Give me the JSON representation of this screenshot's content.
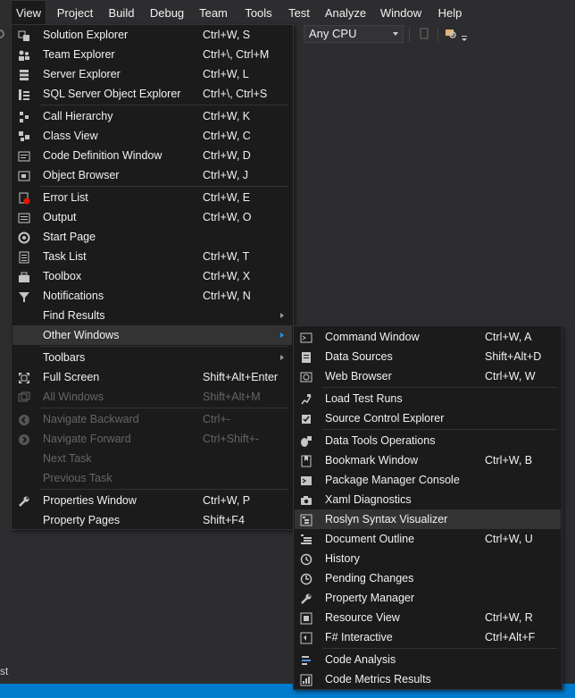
{
  "menubar": [
    "View",
    "Project",
    "Build",
    "Debug",
    "Team",
    "Tools",
    "Test",
    "Analyze",
    "Window",
    "Help"
  ],
  "toolbar": {
    "platform": "Any CPU"
  },
  "left_edge_text": "st",
  "view_menu": [
    {
      "label": "Solution Explorer",
      "shortcut": "Ctrl+W, S",
      "icon": "solution-explorer-icon"
    },
    {
      "label": "Team Explorer",
      "shortcut": "Ctrl+\\, Ctrl+M",
      "icon": "team-explorer-icon"
    },
    {
      "label": "Server Explorer",
      "shortcut": "Ctrl+W, L",
      "icon": "server-explorer-icon"
    },
    {
      "label": "SQL Server Object Explorer",
      "shortcut": "Ctrl+\\, Ctrl+S",
      "icon": "sql-server-icon"
    },
    {
      "label": "Call Hierarchy",
      "shortcut": "Ctrl+W, K",
      "icon": "call-hierarchy-icon"
    },
    {
      "label": "Class View",
      "shortcut": "Ctrl+W, C",
      "icon": "class-view-icon"
    },
    {
      "label": "Code Definition Window",
      "shortcut": "Ctrl+W, D",
      "icon": "code-definition-icon"
    },
    {
      "label": "Object Browser",
      "shortcut": "Ctrl+W, J",
      "icon": "object-browser-icon"
    },
    {
      "label": "Error List",
      "shortcut": "Ctrl+W, E",
      "icon": "error-list-icon"
    },
    {
      "label": "Output",
      "shortcut": "Ctrl+W, O",
      "icon": "output-icon"
    },
    {
      "label": "Start Page",
      "shortcut": "",
      "icon": "start-page-icon"
    },
    {
      "label": "Task List",
      "shortcut": "Ctrl+W, T",
      "icon": "task-list-icon"
    },
    {
      "label": "Toolbox",
      "shortcut": "Ctrl+W, X",
      "icon": "toolbox-icon"
    },
    {
      "label": "Notifications",
      "shortcut": "Ctrl+W, N",
      "icon": "notifications-icon"
    },
    {
      "label": "Find Results",
      "shortcut": "",
      "icon": ""
    },
    {
      "label": "Other Windows",
      "shortcut": "",
      "icon": ""
    },
    {
      "label": "Toolbars",
      "shortcut": "",
      "icon": ""
    },
    {
      "label": "Full Screen",
      "shortcut": "Shift+Alt+Enter",
      "icon": "full-screen-icon"
    },
    {
      "label": "All Windows",
      "shortcut": "Shift+Alt+M",
      "icon": "all-windows-icon"
    },
    {
      "label": "Navigate Backward",
      "shortcut": "Ctrl+-",
      "icon": "navigate-backward-icon"
    },
    {
      "label": "Navigate Forward",
      "shortcut": "Ctrl+Shift+-",
      "icon": "navigate-forward-icon"
    },
    {
      "label": "Next Task",
      "shortcut": "",
      "icon": ""
    },
    {
      "label": "Previous Task",
      "shortcut": "",
      "icon": ""
    },
    {
      "label": "Properties Window",
      "shortcut": "Ctrl+W, P",
      "icon": "wrench-icon"
    },
    {
      "label": "Property Pages",
      "shortcut": "Shift+F4",
      "icon": ""
    }
  ],
  "other_windows_menu": [
    {
      "label": "Command Window",
      "shortcut": "Ctrl+W, A",
      "icon": "command-window-icon"
    },
    {
      "label": "Data Sources",
      "shortcut": "Shift+Alt+D",
      "icon": "data-sources-icon"
    },
    {
      "label": "Web Browser",
      "shortcut": "Ctrl+W, W",
      "icon": "web-browser-icon"
    },
    {
      "label": "Load Test Runs",
      "shortcut": "",
      "icon": "load-test-runs-icon"
    },
    {
      "label": "Source Control Explorer",
      "shortcut": "",
      "icon": "source-control-icon"
    },
    {
      "label": "Data Tools Operations",
      "shortcut": "",
      "icon": "data-tools-icon"
    },
    {
      "label": "Bookmark Window",
      "shortcut": "Ctrl+W, B",
      "icon": "bookmark-icon"
    },
    {
      "label": "Package Manager Console",
      "shortcut": "",
      "icon": "package-manager-icon"
    },
    {
      "label": "Xaml Diagnostics",
      "shortcut": "",
      "icon": "camera-icon"
    },
    {
      "label": "Roslyn Syntax Visualizer",
      "shortcut": "",
      "icon": "syntax-visualizer-icon"
    },
    {
      "label": "Document Outline",
      "shortcut": "Ctrl+W, U",
      "icon": "document-outline-icon"
    },
    {
      "label": "History",
      "shortcut": "",
      "icon": "history-icon"
    },
    {
      "label": "Pending Changes",
      "shortcut": "",
      "icon": "pending-changes-icon"
    },
    {
      "label": "Property Manager",
      "shortcut": "",
      "icon": "wrench-icon"
    },
    {
      "label": "Resource View",
      "shortcut": "Ctrl+W, R",
      "icon": "resource-view-icon"
    },
    {
      "label": "F# Interactive",
      "shortcut": "Ctrl+Alt+F",
      "icon": "fsharp-interactive-icon"
    },
    {
      "label": "Code Analysis",
      "shortcut": "",
      "icon": "code-analysis-icon"
    },
    {
      "label": "Code Metrics Results",
      "shortcut": "",
      "icon": "code-metrics-icon"
    }
  ],
  "colors": {
    "background": "#2d2d30",
    "menu_bg": "#1b1b1c",
    "highlight": "#333334",
    "disabled": "#656565",
    "accent": "#007acc"
  }
}
